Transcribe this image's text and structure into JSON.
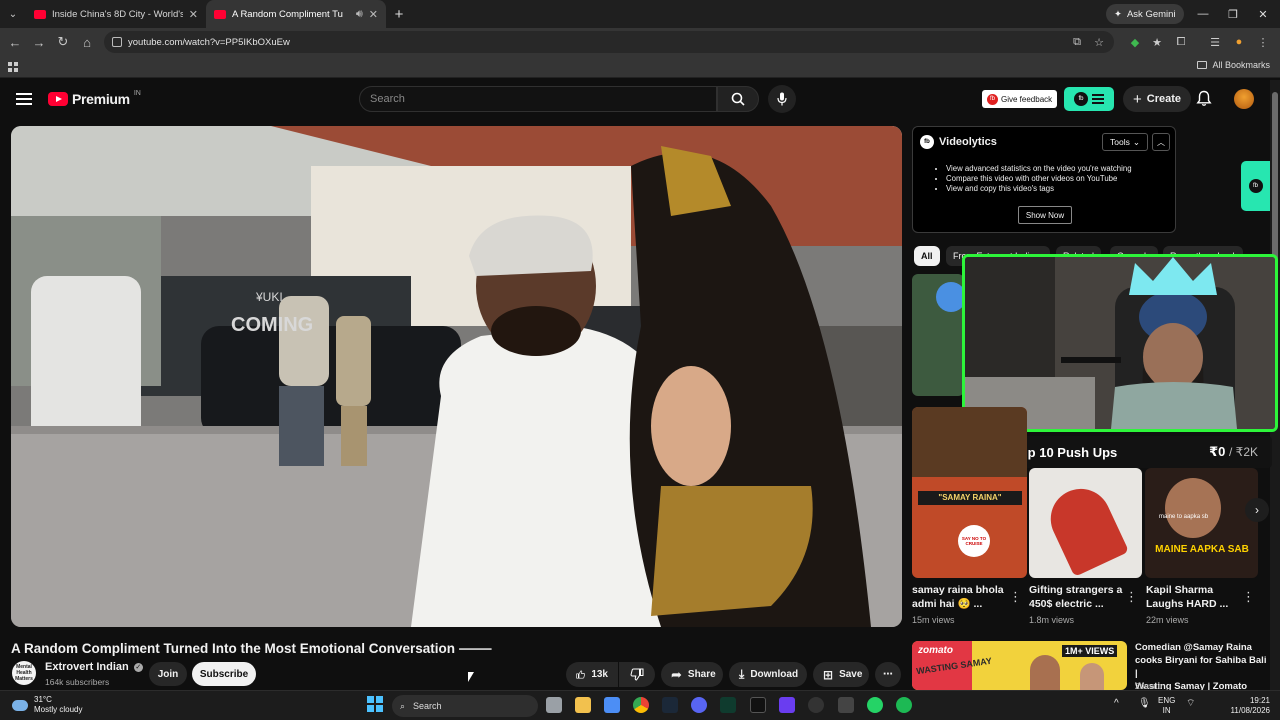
{
  "browser": {
    "tabs": [
      {
        "title": "Inside China's 8D City - World's",
        "active": false
      },
      {
        "title": "A Random Compliment Tu",
        "active": true
      }
    ],
    "ask_gemini": "Ask Gemini",
    "url": "youtube.com/watch?v=PP5IKbOXuEw",
    "all_bookmarks": "All Bookmarks"
  },
  "youtube": {
    "logo_word": "Premium",
    "logo_country": "IN",
    "search_placeholder": "Search",
    "give_feedback": "Give feedback",
    "create": "Create"
  },
  "video": {
    "title": "A Random Compliment Turned Into the Most Emotional Conversation ⸻",
    "channel": "Extrovert Indian",
    "channel_avatar_text": "Mental Health Matters",
    "subscribers": "164k subscribers",
    "join": "Join",
    "subscribe": "Subscribe",
    "likes": "13k",
    "share": "Share",
    "download": "Download",
    "save": "Save"
  },
  "videolytics": {
    "name": "Videolytics",
    "tools": "Tools",
    "features": [
      "View advanced statistics on the video you're watching",
      "Compare this video with other videos on YouTube",
      "View and copy this video's tags"
    ],
    "show_now": "Show Now"
  },
  "chips": [
    "All",
    "From Extrovert Indian",
    "Related",
    "Comedy",
    "Recently uploaded"
  ],
  "overlay": {
    "label": "!supertip 10 Push Ups",
    "amount": "₹0",
    "goal": "/ ₹2K"
  },
  "recommendations": [
    {
      "title_line1": "samay raina bhola",
      "title_line2": "admi hai 🥺 ...",
      "meta": "15m views",
      "thumb_text": "\"SAMAY RAINA\"",
      "thumb_subtext": "SAY NO TO CRUISE"
    },
    {
      "title_line1": "Gifting strangers a",
      "title_line2": "450$ electric ...",
      "meta": "1.8m views"
    },
    {
      "title_line1": "Kapil Sharma",
      "title_line2": "Laughs HARD ...",
      "meta": "22m views",
      "thumb_text": "MAINE AAPKA SAB",
      "thumb_subtext": "maine to aapka sb"
    }
  ],
  "rec_row2": {
    "title_line1": "Comedian @Samay Raina",
    "title_line2": "cooks Biryani for Sahiba Bali |",
    "title_line3": "Wasting Samay | Zomato",
    "channel": "Zomato",
    "thumb_brand": "zomato",
    "thumb_badge": "1M+ VIEWS",
    "thumb_tag": "WASTING SAMAY"
  },
  "taskbar": {
    "temperature": "31°C",
    "condition": "Mostly cloudy",
    "search": "Search",
    "lang1": "ENG",
    "lang2": "IN",
    "time": "19:21",
    "date": "11/08/2026"
  },
  "colors": {
    "youtube_red": "#ff0033",
    "videolytics_accent": "#27e6b0",
    "webcam_border": "#2df53a",
    "background": "#0f0f0f"
  }
}
